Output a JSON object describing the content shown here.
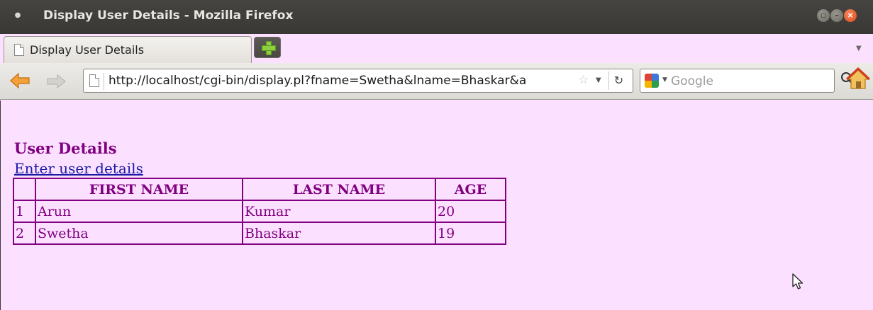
{
  "window": {
    "title": "Display User Details - Mozilla Firefox"
  },
  "tabs": [
    {
      "label": "Display User Details",
      "active": true
    }
  ],
  "navbar": {
    "url": "http://localhost/cgi-bin/display.pl?fname=Swetha&lname=Bhaskar&a",
    "search_placeholder": "Google"
  },
  "page": {
    "heading": "User Details",
    "link_text": "Enter user details",
    "table": {
      "headers": [
        "",
        "FIRST NAME",
        "LAST NAME",
        "AGE"
      ],
      "rows": [
        [
          "1",
          "Arun",
          "Kumar",
          "20"
        ],
        [
          "2",
          "Swetha",
          "Bhaskar",
          "19"
        ]
      ]
    }
  },
  "colors": {
    "page_background": "#fce0ff",
    "text_purple": "#800080",
    "link_blue": "#1a1aa6",
    "titlebar": "#3c3b37",
    "close_button": "#e8531c"
  },
  "icons": {
    "back": "arrow-left-icon",
    "forward": "arrow-right-icon",
    "bookmark": "star-icon",
    "reload": "reload-icon",
    "search": "magnifier-icon",
    "home": "home-icon",
    "new_tab": "plus-icon"
  }
}
